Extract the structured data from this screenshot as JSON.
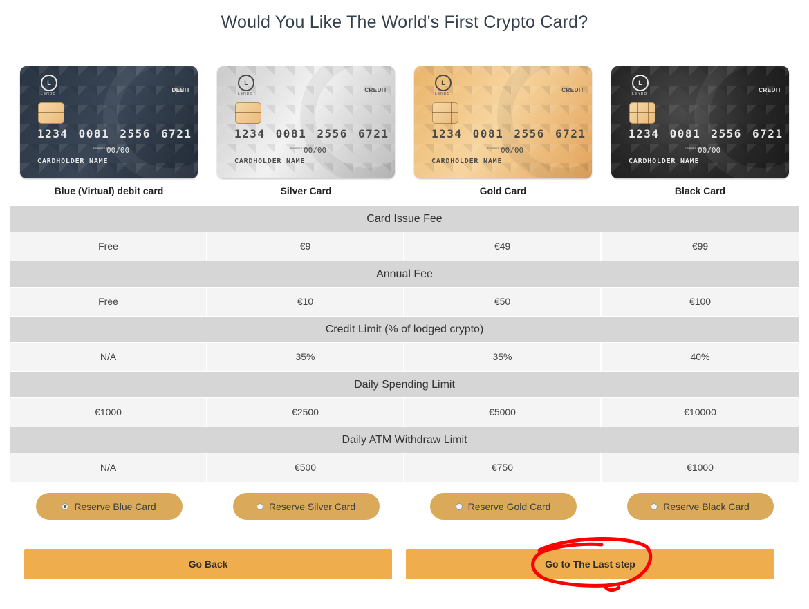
{
  "title": "Would You Like The World's First Crypto Card?",
  "cards": [
    {
      "name": "Blue (Virtual) debit card",
      "type_label": "DEBIT",
      "number": "1234 0081 2556 6721",
      "expiry": "00/00",
      "expiry_label": "EXPIRES ENDS",
      "holder": "CARDHOLDER NAME",
      "logo_letter": "L",
      "logo_text": "LENDO"
    },
    {
      "name": "Silver Card",
      "type_label": "CREDIT",
      "number": "1234 0081 2556 6721",
      "expiry": "00/00",
      "expiry_label": "EXPIRES ENDS",
      "holder": "CARDHOLDER NAME",
      "logo_letter": "L",
      "logo_text": "LENDO"
    },
    {
      "name": "Gold Card",
      "type_label": "CREDIT",
      "number": "1234 0081 2556 6721",
      "expiry": "00/00",
      "expiry_label": "EXPIRES ENDS",
      "holder": "CARDHOLDER NAME",
      "logo_letter": "L",
      "logo_text": "LENDO"
    },
    {
      "name": "Black Card",
      "type_label": "CREDIT",
      "number": "1234 0081 2556 6721",
      "expiry": "00/00",
      "expiry_label": "EXPIRES ENDS",
      "holder": "CARDHOLDER NAME",
      "logo_letter": "L",
      "logo_text": "LENDO"
    }
  ],
  "sections": [
    {
      "header": "Card Issue Fee",
      "values": [
        "Free",
        "€9",
        "€49",
        "€99"
      ]
    },
    {
      "header": "Annual Fee",
      "values": [
        "Free",
        "€10",
        "€50",
        "€100"
      ]
    },
    {
      "header": "Credit Limit (% of lodged crypto)",
      "values": [
        "N/A",
        "35%",
        "35%",
        "40%"
      ]
    },
    {
      "header": "Daily Spending Limit",
      "values": [
        "€1000",
        "€2500",
        "€5000",
        "€10000"
      ]
    },
    {
      "header": "Daily ATM Withdraw Limit",
      "values": [
        "N/A",
        "€500",
        "€750",
        "€1000"
      ]
    }
  ],
  "reserve_options": [
    {
      "label": "Reserve Blue Card",
      "selected": true
    },
    {
      "label": "Reserve Silver Card",
      "selected": false
    },
    {
      "label": "Reserve Gold Card",
      "selected": false
    },
    {
      "label": "Reserve Black Card",
      "selected": false
    }
  ],
  "buttons": {
    "back": "Go Back",
    "next": "Go to The Last step"
  },
  "colors": {
    "button": "#f0ad4e",
    "reserve": "#dba95a",
    "header_row": "#d6d6d6",
    "annotation": "#ff0000"
  }
}
